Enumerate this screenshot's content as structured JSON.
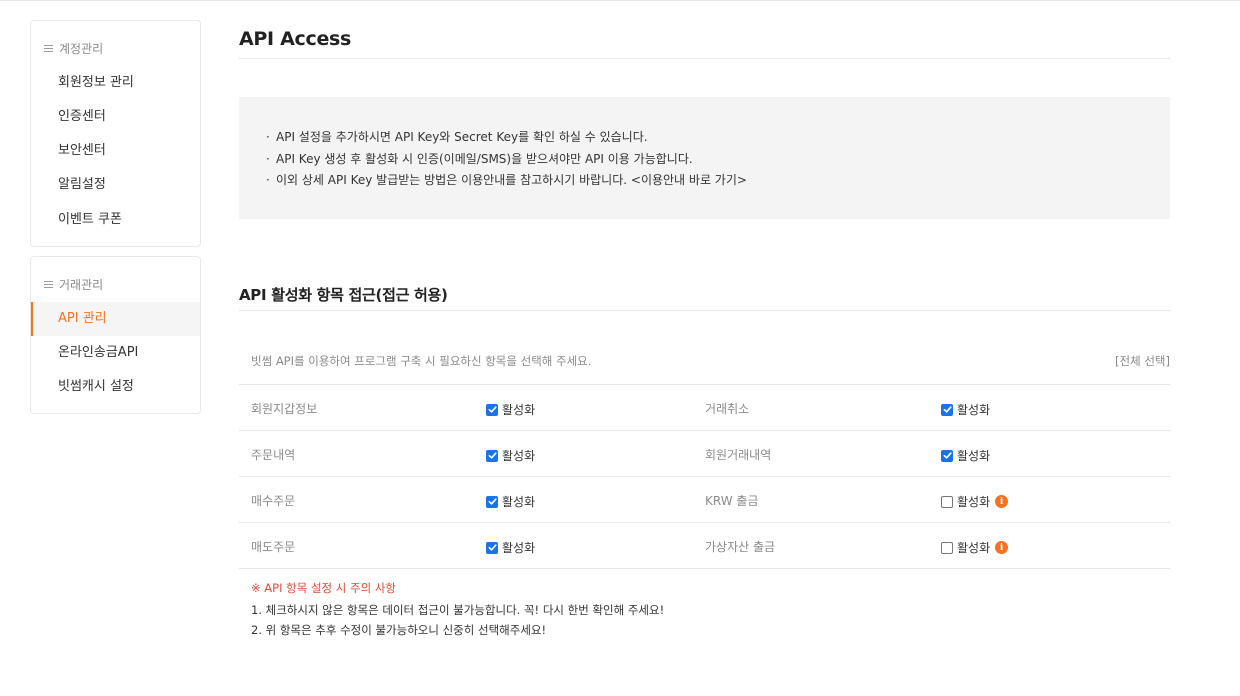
{
  "sidebar": {
    "account": {
      "header": "계정관리",
      "items": [
        "회원정보 관리",
        "인증센터",
        "보안센터",
        "알림설정",
        "이벤트 쿠폰"
      ]
    },
    "trade": {
      "header": "거래관리",
      "items": [
        "API 관리",
        "온라인송금API",
        "빗썸캐시 설정"
      ],
      "active_index": 0
    }
  },
  "page": {
    "title": "API Access"
  },
  "notice": {
    "bullet": "·",
    "lines": [
      "API 설정을 추가하시면 API Key와 Secret Key를 확인 하실 수 있습니다.",
      "API Key 생성 후 활성화 시 인증(이메일/SMS)을 받으셔야만 API 이용 가능합니다.",
      "이외 상세 API Key 발급받는 방법은 이용안내를 참고하시기 바랍니다. <이용안내 바로 가기>"
    ]
  },
  "permissions": {
    "title": "API 활성화 항목 접근(접근 허용)",
    "description": "빗썸 API를 이용하여 프로그램 구축 시 필요하신 항목을 선택해 주세요.",
    "select_all": "[전체 선택]",
    "activate_label": "활성화",
    "rows": [
      [
        {
          "label": "회원지갑정보",
          "checked": true,
          "info": false
        },
        {
          "label": "거래취소",
          "checked": true,
          "info": false
        }
      ],
      [
        {
          "label": "주문내역",
          "checked": true,
          "info": false
        },
        {
          "label": "회원거래내역",
          "checked": true,
          "info": false
        }
      ],
      [
        {
          "label": "매수주문",
          "checked": true,
          "info": false
        },
        {
          "label": "KRW 출금",
          "checked": false,
          "info": true
        }
      ],
      [
        {
          "label": "매도주문",
          "checked": true,
          "info": false
        },
        {
          "label": "가상자산 출금",
          "checked": false,
          "info": true
        }
      ]
    ],
    "info_glyph": "i"
  },
  "caution": {
    "title": "※ API 항목 설정 시 주의 사항",
    "lines": [
      "1. 체크하시지 않은 항목은 데이터 접근이 불가능합니다. 꼭! 다시 한번 확인해 주세요!",
      "2. 위 항목은 추후 수정이 불가능하오니 신중히 선택해주세요!"
    ]
  },
  "colors": {
    "accent": "#f37321",
    "checkbox": "#1a73e8",
    "caution": "#e04a3a"
  }
}
